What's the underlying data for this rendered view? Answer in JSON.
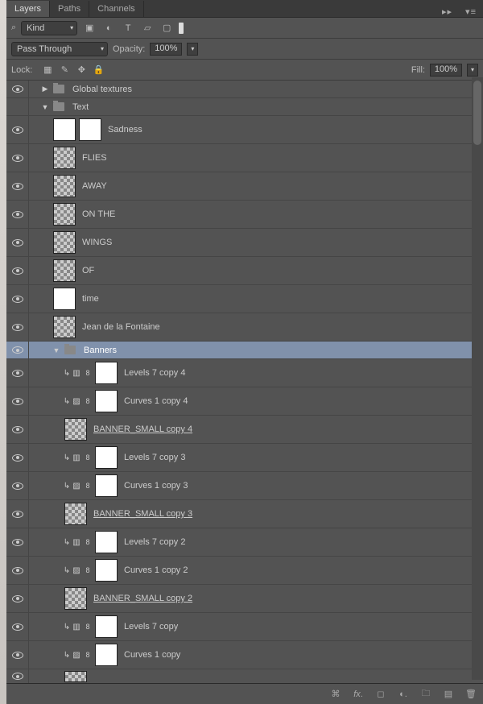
{
  "tabs": {
    "layers": "Layers",
    "paths": "Paths",
    "channels": "Channels"
  },
  "filter": {
    "label": "Kind"
  },
  "blend": {
    "mode": "Pass Through",
    "opacity_label": "Opacity:",
    "opacity_value": "100%"
  },
  "lock": {
    "label": "Lock:",
    "fill_label": "Fill:",
    "fill_value": "100%"
  },
  "groups": {
    "global": "Global textures",
    "text": "Text",
    "banners": "Banners"
  },
  "textLayers": [
    "Sadness",
    "FLIES",
    "AWAY",
    "ON THE",
    "WINGS",
    "OF",
    "time",
    "Jean de la Fontaine"
  ],
  "bannerSets": [
    {
      "levels": "Levels 7 copy 4",
      "curves": "Curves 1 copy 4",
      "banner": "BANNER_SMALL copy 4"
    },
    {
      "levels": "Levels 7 copy 3",
      "curves": "Curves 1 copy 3",
      "banner": "BANNER_SMALL copy 3"
    },
    {
      "levels": "Levels 7 copy 2",
      "curves": "Curves 1 copy 2",
      "banner": "BANNER_SMALL copy 2"
    },
    {
      "levels": "Levels 7 copy",
      "curves": "Curves 1 copy",
      "banner": ""
    }
  ],
  "icons": {
    "menu": "≡"
  }
}
